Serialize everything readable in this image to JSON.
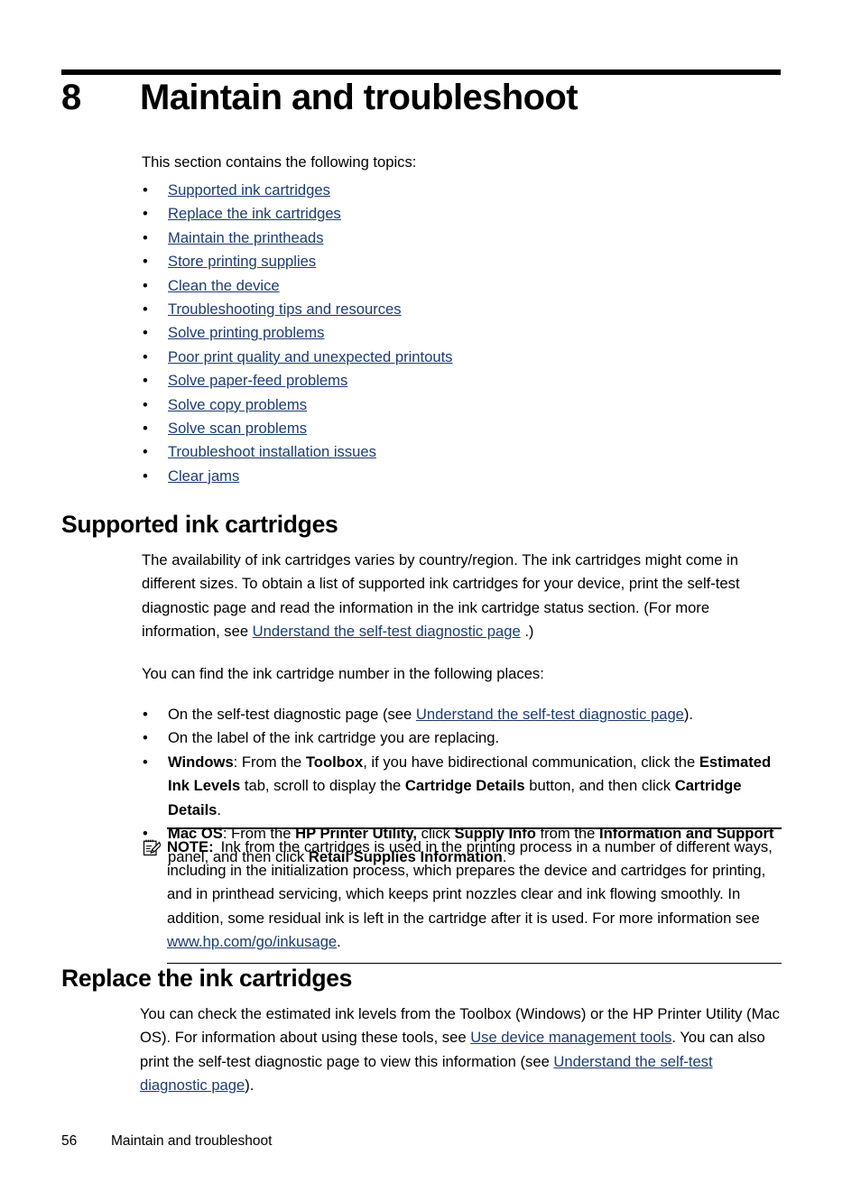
{
  "chapter": {
    "number": "8",
    "title": "Maintain and troubleshoot"
  },
  "intro": {
    "lead": "This section contains the following topics:"
  },
  "toc": {
    "items": [
      {
        "label": "Supported ink cartridges"
      },
      {
        "label": "Replace the ink cartridges"
      },
      {
        "label": "Maintain the printheads"
      },
      {
        "label": "Store printing supplies"
      },
      {
        "label": "Clean the device"
      },
      {
        "label": "Troubleshooting tips and resources"
      },
      {
        "label": "Solve printing problems"
      },
      {
        "label": "Poor print quality and unexpected printouts"
      },
      {
        "label": "Solve paper-feed problems"
      },
      {
        "label": "Solve copy problems"
      },
      {
        "label": "Solve scan problems"
      },
      {
        "label": "Troubleshoot installation issues"
      },
      {
        "label": "Clear jams"
      }
    ]
  },
  "supported_ink_cartridges": {
    "heading": "Supported ink cartridges",
    "para1_a": "The availability of ink cartridges varies by country/region. The ink cartridges might come in different sizes. To obtain a list of supported ink cartridges for your device, print the self-test diagnostic page and read the information in the ink cartridge status section. (For more information, see ",
    "para1_link": "Understand the self-test diagnostic page",
    "para1_b": " .)",
    "para2": "You can find the ink cartridge number in the following places:",
    "bullet1_a": "On the self-test diagnostic page (see ",
    "bullet1_link": "Understand the self-test diagnostic page",
    "bullet1_b": ").",
    "bullet2": "On the label of the ink cartridge you are replacing.",
    "bullet3_b1": "Windows",
    "bullet3_t1": ": From the ",
    "bullet3_b2": "Toolbox",
    "bullet3_t2": ", if you have bidirectional communication, click the ",
    "bullet3_b3": "Estimated Ink Levels",
    "bullet3_t3": " tab, scroll to display the ",
    "bullet3_b4": "Cartridge Details",
    "bullet3_t4": " button, and then click ",
    "bullet3_b5": "Cartridge Details",
    "bullet3_t5": ".",
    "bullet4_b1": "Mac OS",
    "bullet4_t1": ": From the ",
    "bullet4_b2": "HP Printer Utility,",
    "bullet4_t2": " click ",
    "bullet4_b3": "Supply Info",
    "bullet4_t3": " from the ",
    "bullet4_b4": "Information and Support",
    "bullet4_t4": " panel, and then click ",
    "bullet4_b5": "Retail Supplies Information",
    "bullet4_t5": "."
  },
  "note": {
    "icon": "note-pad-pencil-icon",
    "label": "NOTE:",
    "text_a": "Ink from the cartridges is used in the printing process in a number of different ways, including in the initialization process, which prepares the device and cartridges for printing, and in printhead servicing, which keeps print nozzles clear and ink flowing smoothly. In addition, some residual ink is left in the cartridge after it is used. For more information see ",
    "text_link": "www.hp.com/go/inkusage",
    "text_b": "."
  },
  "replace_ink_cartridges": {
    "heading": "Replace the ink cartridges",
    "para_a": "You can check the estimated ink levels from the Toolbox (Windows) or the HP Printer Utility (Mac OS). For information about using these tools, see ",
    "para_link1": "Use device management tools",
    "para_b": ". You can also print the self-test diagnostic page to view this information (see ",
    "para_link2": "Understand the self-test diagnostic page",
    "para_c": ")."
  },
  "footer": {
    "page_number": "56",
    "title": "Maintain and troubleshoot"
  },
  "colors": {
    "link": "#1c3c72",
    "text": "#000000",
    "background": "#ffffff"
  }
}
